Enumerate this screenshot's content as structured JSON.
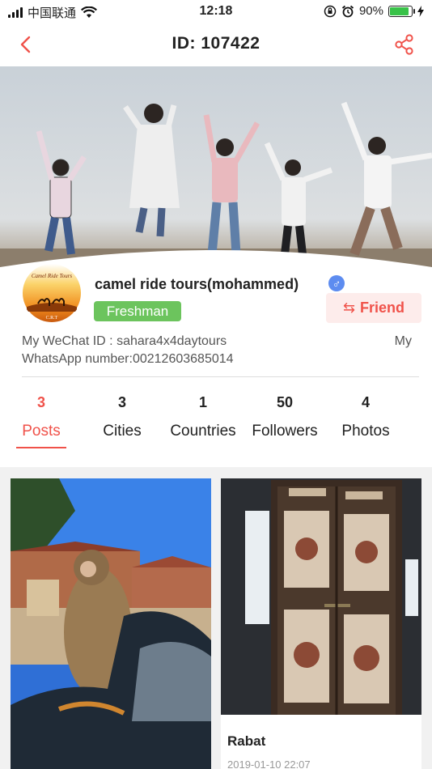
{
  "status_bar": {
    "carrier": "中国联通",
    "time": "12:18",
    "battery_percent": "90%",
    "battery_level": 0.9
  },
  "nav": {
    "title": "ID: 107422"
  },
  "profile": {
    "nickname": "camel ride tours(mohammed)",
    "gender_symbol": "♂",
    "level": "Freshman",
    "friend_label": "Friend",
    "avatar_text_top": "Camel Ride Tours",
    "avatar_text_bottom": "C.R.T",
    "bio_line1_left": "My WeChat ID : sahara4x4daytours",
    "bio_line1_right": "My",
    "bio_line2": "WhatsApp number:00212603685014"
  },
  "stats": [
    {
      "value": "3",
      "label": "Posts"
    },
    {
      "value": "3",
      "label": "Cities"
    },
    {
      "value": "1",
      "label": "Countries"
    },
    {
      "value": "50",
      "label": "Followers"
    },
    {
      "value": "4",
      "label": "Photos"
    }
  ],
  "posts": [
    {
      "title": "",
      "date": ""
    },
    {
      "title": "Rabat",
      "date": "2019-01-10 22:07"
    }
  ],
  "colors": {
    "accent": "#f0524a",
    "level_badge": "#6cc45d",
    "gender": "#5d8cf0"
  }
}
